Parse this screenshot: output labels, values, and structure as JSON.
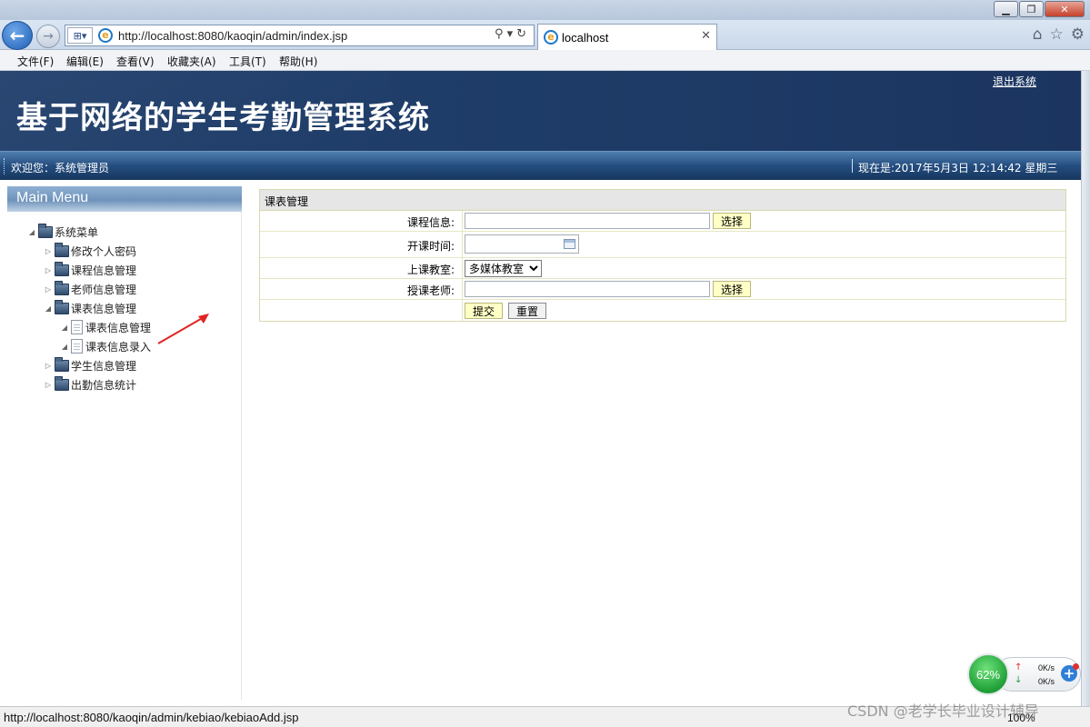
{
  "browser": {
    "url": "http://localhost:8080/kaoqin/admin/index.jsp",
    "tab_title": "localhost",
    "menu": [
      "文件(F)",
      "编辑(E)",
      "查看(V)",
      "收藏夹(A)",
      "工具(T)",
      "帮助(H)"
    ]
  },
  "header": {
    "site_title": "基于网络的学生考勤管理系统",
    "logout": "退出系统",
    "welcome": "欢迎您：系统管理员",
    "datetime": "现在是:2017年5月3日 12:14:42 星期三"
  },
  "sidebar": {
    "header": "Main Menu",
    "root": "系统菜单",
    "items": [
      {
        "label": "修改个人密码",
        "type": "folder"
      },
      {
        "label": "课程信息管理",
        "type": "folder"
      },
      {
        "label": "老师信息管理",
        "type": "folder"
      },
      {
        "label": "课表信息管理",
        "type": "folder",
        "expanded": true
      },
      {
        "label": "课表信息管理",
        "type": "file"
      },
      {
        "label": "课表信息录入",
        "type": "file"
      },
      {
        "label": "学生信息管理",
        "type": "folder"
      },
      {
        "label": "出勤信息统计",
        "type": "folder"
      }
    ]
  },
  "form": {
    "title": "课表管理",
    "course_label": "课程信息:",
    "course_value": "",
    "time_label": "开课时间:",
    "time_value": "",
    "room_label": "上课教室:",
    "room_selected": "多媒体教室",
    "teacher_label": "授课老师:",
    "teacher_value": "",
    "pick_button": "选择",
    "submit_button": "提交",
    "reset_button": "重置"
  },
  "widget": {
    "usage": "62%",
    "upload_speed": "0K/s",
    "download_speed": "0K/s"
  },
  "status": {
    "url": "http://localhost:8080/kaoqin/admin/kebiao/kebiaoAdd.jsp",
    "zoom": "100%",
    "watermark": "CSDN @老学长毕业设计辅导"
  },
  "colors": {
    "banner": "#1d3a63",
    "infobar": "#244d7f",
    "button_yellow": "#ffffc6"
  }
}
